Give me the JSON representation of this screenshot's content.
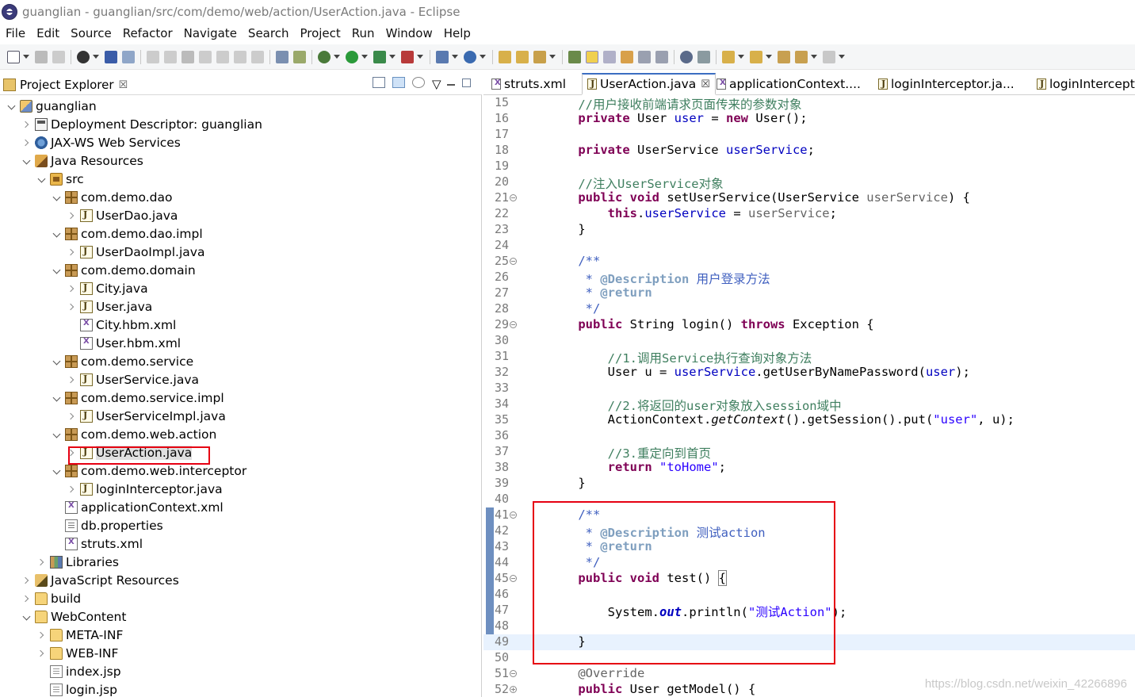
{
  "window": {
    "title": "guanglian - guanglian/src/com/demo/web/action/UserAction.java - Eclipse"
  },
  "menu": [
    "File",
    "Edit",
    "Source",
    "Refactor",
    "Navigate",
    "Search",
    "Project",
    "Run",
    "Window",
    "Help"
  ],
  "explorer": {
    "title": "Project Explorer",
    "close": "☒",
    "items": [
      {
        "label": "guanglian",
        "depth": 0,
        "arrow": "down",
        "icon": "project"
      },
      {
        "label": "Deployment Descriptor: guanglian",
        "depth": 1,
        "arrow": "right",
        "icon": "deploy"
      },
      {
        "label": "JAX-WS Web Services",
        "depth": 1,
        "arrow": "right",
        "icon": "ws"
      },
      {
        "label": "Java Resources",
        "depth": 1,
        "arrow": "down",
        "icon": "javares"
      },
      {
        "label": "src",
        "depth": 2,
        "arrow": "down",
        "icon": "src"
      },
      {
        "label": "com.demo.dao",
        "depth": 3,
        "arrow": "down",
        "icon": "pkg"
      },
      {
        "label": "UserDao.java",
        "depth": 4,
        "arrow": "right",
        "icon": "java"
      },
      {
        "label": "com.demo.dao.impl",
        "depth": 3,
        "arrow": "down",
        "icon": "pkg"
      },
      {
        "label": "UserDaoImpl.java",
        "depth": 4,
        "arrow": "right",
        "icon": "java"
      },
      {
        "label": "com.demo.domain",
        "depth": 3,
        "arrow": "down",
        "icon": "pkg"
      },
      {
        "label": "City.java",
        "depth": 4,
        "arrow": "right",
        "icon": "java"
      },
      {
        "label": "User.java",
        "depth": 4,
        "arrow": "right",
        "icon": "java"
      },
      {
        "label": "City.hbm.xml",
        "depth": 4,
        "arrow": "none",
        "icon": "xml"
      },
      {
        "label": "User.hbm.xml",
        "depth": 4,
        "arrow": "none",
        "icon": "xml"
      },
      {
        "label": "com.demo.service",
        "depth": 3,
        "arrow": "down",
        "icon": "pkg"
      },
      {
        "label": "UserService.java",
        "depth": 4,
        "arrow": "right",
        "icon": "java"
      },
      {
        "label": "com.demo.service.impl",
        "depth": 3,
        "arrow": "down",
        "icon": "pkg"
      },
      {
        "label": "UserServiceImpl.java",
        "depth": 4,
        "arrow": "right",
        "icon": "java"
      },
      {
        "label": "com.demo.web.action",
        "depth": 3,
        "arrow": "down",
        "icon": "pkg"
      },
      {
        "label": "UserAction.java",
        "depth": 4,
        "arrow": "right",
        "icon": "java",
        "selected": true
      },
      {
        "label": "com.demo.web.interceptor",
        "depth": 3,
        "arrow": "down",
        "icon": "pkg"
      },
      {
        "label": "loginInterceptor.java",
        "depth": 4,
        "arrow": "right",
        "icon": "java"
      },
      {
        "label": "applicationContext.xml",
        "depth": 3,
        "arrow": "none",
        "icon": "xml"
      },
      {
        "label": "db.properties",
        "depth": 3,
        "arrow": "none",
        "icon": "props"
      },
      {
        "label": "struts.xml",
        "depth": 3,
        "arrow": "none",
        "icon": "xml"
      },
      {
        "label": "Libraries",
        "depth": 2,
        "arrow": "right",
        "icon": "lib"
      },
      {
        "label": "JavaScript Resources",
        "depth": 1,
        "arrow": "right",
        "icon": "js"
      },
      {
        "label": "build",
        "depth": 1,
        "arrow": "right",
        "icon": "folder"
      },
      {
        "label": "WebContent",
        "depth": 1,
        "arrow": "down",
        "icon": "folder"
      },
      {
        "label": "META-INF",
        "depth": 2,
        "arrow": "right",
        "icon": "folder"
      },
      {
        "label": "WEB-INF",
        "depth": 2,
        "arrow": "right",
        "icon": "folder"
      },
      {
        "label": "index.jsp",
        "depth": 2,
        "arrow": "none",
        "icon": "jsp"
      },
      {
        "label": "login.jsp",
        "depth": 2,
        "arrow": "none",
        "icon": "jsp"
      }
    ]
  },
  "editor": {
    "tabs": [
      {
        "label": "struts.xml",
        "icon": "xml",
        "active": false
      },
      {
        "label": "UserAction.java",
        "icon": "java",
        "active": true,
        "close": "☒"
      },
      {
        "label": "applicationContext....",
        "icon": "xml",
        "active": false
      },
      {
        "label": "loginInterceptor.ja...",
        "icon": "java",
        "active": false
      },
      {
        "label": "loginIntercepto",
        "icon": "java",
        "active": false
      }
    ],
    "lines": [
      {
        "n": "15",
        "parts": [
          [
            "    ",
            ""
          ],
          [
            "//用户接收前端请求页面传来的参数对象",
            "cm"
          ]
        ]
      },
      {
        "n": "16",
        "parts": [
          [
            "    ",
            ""
          ],
          [
            "private",
            "kw"
          ],
          [
            " User ",
            ""
          ],
          [
            "user",
            "fld"
          ],
          [
            " = ",
            ""
          ],
          [
            "new",
            "kw"
          ],
          [
            " User();",
            ""
          ]
        ]
      },
      {
        "n": "17",
        "parts": []
      },
      {
        "n": "18",
        "parts": [
          [
            "    ",
            ""
          ],
          [
            "private",
            "kw"
          ],
          [
            " UserService ",
            ""
          ],
          [
            "userService",
            "fld"
          ],
          [
            ";",
            ""
          ]
        ]
      },
      {
        "n": "19",
        "parts": []
      },
      {
        "n": "20",
        "parts": [
          [
            "    ",
            ""
          ],
          [
            "//注入UserService对象",
            "cm"
          ]
        ]
      },
      {
        "n": "21",
        "fold": "minus",
        "parts": [
          [
            "    ",
            ""
          ],
          [
            "public",
            "kw"
          ],
          [
            " ",
            ""
          ],
          [
            "void",
            "kw"
          ],
          [
            " setUserService(UserService ",
            ""
          ],
          [
            "userService",
            "ann"
          ],
          [
            ") {",
            ""
          ]
        ]
      },
      {
        "n": "22",
        "parts": [
          [
            "        ",
            ""
          ],
          [
            "this",
            "kw"
          ],
          [
            ".",
            ""
          ],
          [
            "userService",
            "fld"
          ],
          [
            " = ",
            ""
          ],
          [
            "userService",
            "ann"
          ],
          [
            ";",
            ""
          ]
        ]
      },
      {
        "n": "23",
        "parts": [
          [
            "    }",
            ""
          ]
        ]
      },
      {
        "n": "24",
        "parts": []
      },
      {
        "n": "25",
        "fold": "minus",
        "parts": [
          [
            "    ",
            ""
          ],
          [
            "/**",
            "jd"
          ]
        ]
      },
      {
        "n": "26",
        "parts": [
          [
            "     * ",
            "jd"
          ],
          [
            "@Description",
            "jdtag"
          ],
          [
            " 用户登录方法",
            "jd"
          ]
        ]
      },
      {
        "n": "27",
        "parts": [
          [
            "     * ",
            "jd"
          ],
          [
            "@return",
            "jdtag"
          ]
        ]
      },
      {
        "n": "28",
        "parts": [
          [
            "     */",
            "jd"
          ]
        ]
      },
      {
        "n": "29",
        "fold": "minus",
        "parts": [
          [
            "    ",
            ""
          ],
          [
            "public",
            "kw"
          ],
          [
            " String login() ",
            ""
          ],
          [
            "throws",
            "kw"
          ],
          [
            " Exception {",
            ""
          ]
        ]
      },
      {
        "n": "30",
        "parts": []
      },
      {
        "n": "31",
        "parts": [
          [
            "        ",
            ""
          ],
          [
            "//1.调用Service执行查询对象方法",
            "cm"
          ]
        ]
      },
      {
        "n": "32",
        "parts": [
          [
            "        User u = ",
            ""
          ],
          [
            "userService",
            "fld"
          ],
          [
            ".getUserByNamePassword(",
            ""
          ],
          [
            "user",
            "fld"
          ],
          [
            ");",
            ""
          ]
        ]
      },
      {
        "n": "33",
        "parts": []
      },
      {
        "n": "34",
        "parts": [
          [
            "        ",
            ""
          ],
          [
            "//2.将返回的user对象放入session域中",
            "cm"
          ]
        ]
      },
      {
        "n": "35",
        "parts": [
          [
            "        ActionContext.",
            ""
          ],
          [
            "getContext",
            "itl"
          ],
          [
            "().getSession().put(",
            ""
          ],
          [
            "\"user\"",
            "str"
          ],
          [
            ", u);",
            ""
          ]
        ]
      },
      {
        "n": "36",
        "parts": []
      },
      {
        "n": "37",
        "parts": [
          [
            "        ",
            ""
          ],
          [
            "//3.重定向到首页",
            "cm"
          ]
        ]
      },
      {
        "n": "38",
        "parts": [
          [
            "        ",
            ""
          ],
          [
            "return",
            "kw"
          ],
          [
            " ",
            ""
          ],
          [
            "\"toHome\"",
            "str"
          ],
          [
            ";",
            ""
          ]
        ]
      },
      {
        "n": "39",
        "parts": [
          [
            "    }",
            ""
          ]
        ]
      },
      {
        "n": "40",
        "parts": []
      },
      {
        "n": "41",
        "fold": "minus",
        "parts": [
          [
            "    ",
            ""
          ],
          [
            "/**",
            "jd"
          ]
        ]
      },
      {
        "n": "42",
        "parts": [
          [
            "     * ",
            "jd"
          ],
          [
            "@Description",
            "jdtag"
          ],
          [
            " 测试action",
            "jd"
          ]
        ]
      },
      {
        "n": "43",
        "parts": [
          [
            "     * ",
            "jd"
          ],
          [
            "@return",
            "jdtag"
          ]
        ]
      },
      {
        "n": "44",
        "parts": [
          [
            "     */",
            "jd"
          ]
        ]
      },
      {
        "n": "45",
        "fold": "minus",
        "parts": [
          [
            "    ",
            ""
          ],
          [
            "public",
            "kw"
          ],
          [
            " ",
            ""
          ],
          [
            "void",
            "kw"
          ],
          [
            " test() ",
            ""
          ],
          [
            "{",
            "bracebox"
          ]
        ]
      },
      {
        "n": "46",
        "parts": []
      },
      {
        "n": "47",
        "parts": [
          [
            "        System.",
            ""
          ],
          [
            "out",
            "sf"
          ],
          [
            ".println(",
            ""
          ],
          [
            "\"测试Action\"",
            "str"
          ],
          [
            ");",
            ""
          ]
        ]
      },
      {
        "n": "48",
        "parts": []
      },
      {
        "n": "49",
        "current": true,
        "parts": [
          [
            "    }",
            ""
          ]
        ]
      },
      {
        "n": "50",
        "parts": []
      },
      {
        "n": "51",
        "fold": "minus",
        "parts": [
          [
            "    ",
            ""
          ],
          [
            "@Override",
            "ann"
          ]
        ]
      },
      {
        "n": "52",
        "fold": "plus",
        "parts": [
          [
            "    ",
            ""
          ],
          [
            "public",
            "kw"
          ],
          [
            " User getModel() {",
            ""
          ]
        ]
      }
    ]
  },
  "watermark": "https://blog.csdn.net/weixin_42266896",
  "colors": {
    "highlight_box": "#e60012",
    "keyword": "#7f0055",
    "field": "#0000c0",
    "comment": "#3f7f5f"
  }
}
